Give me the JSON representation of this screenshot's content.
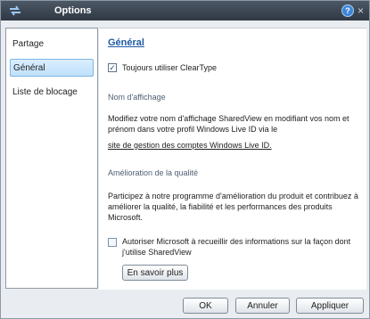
{
  "window": {
    "title": "Options"
  },
  "sidebar": {
    "items": [
      {
        "label": "Partage"
      },
      {
        "label": "Général"
      },
      {
        "label": "Liste de blocage"
      }
    ]
  },
  "general": {
    "title": "Général",
    "cleartype_label": "Toujours utiliser ClearType",
    "cleartype_checked": true,
    "display_name": {
      "title": "Nom d'affichage",
      "text": "Modifiez votre nom d'affichage SharedView en modifiant vos nom et prénom dans votre profil Windows Live ID via le",
      "link": "site de gestion des comptes Windows Live ID."
    },
    "quality": {
      "title": "Amélioration de la qualité",
      "text": "Participez à notre programme d'amélioration du produit et contribuez à améliorer la qualité, la fiabilité et les performances des produits Microsoft.",
      "authorize_label": "Autoriser Microsoft à recueillir des informations sur la façon dont j'utilise SharedView",
      "authorize_checked": false,
      "learn_more_button": "En savoir plus"
    }
  },
  "footer": {
    "ok_button": "OK",
    "cancel_button": "Annuler",
    "apply_button": "Appliquer"
  },
  "colors": {
    "titlebar": "#3b4552",
    "accent": "#1e5aa3",
    "selection": "#bfe0fb"
  }
}
